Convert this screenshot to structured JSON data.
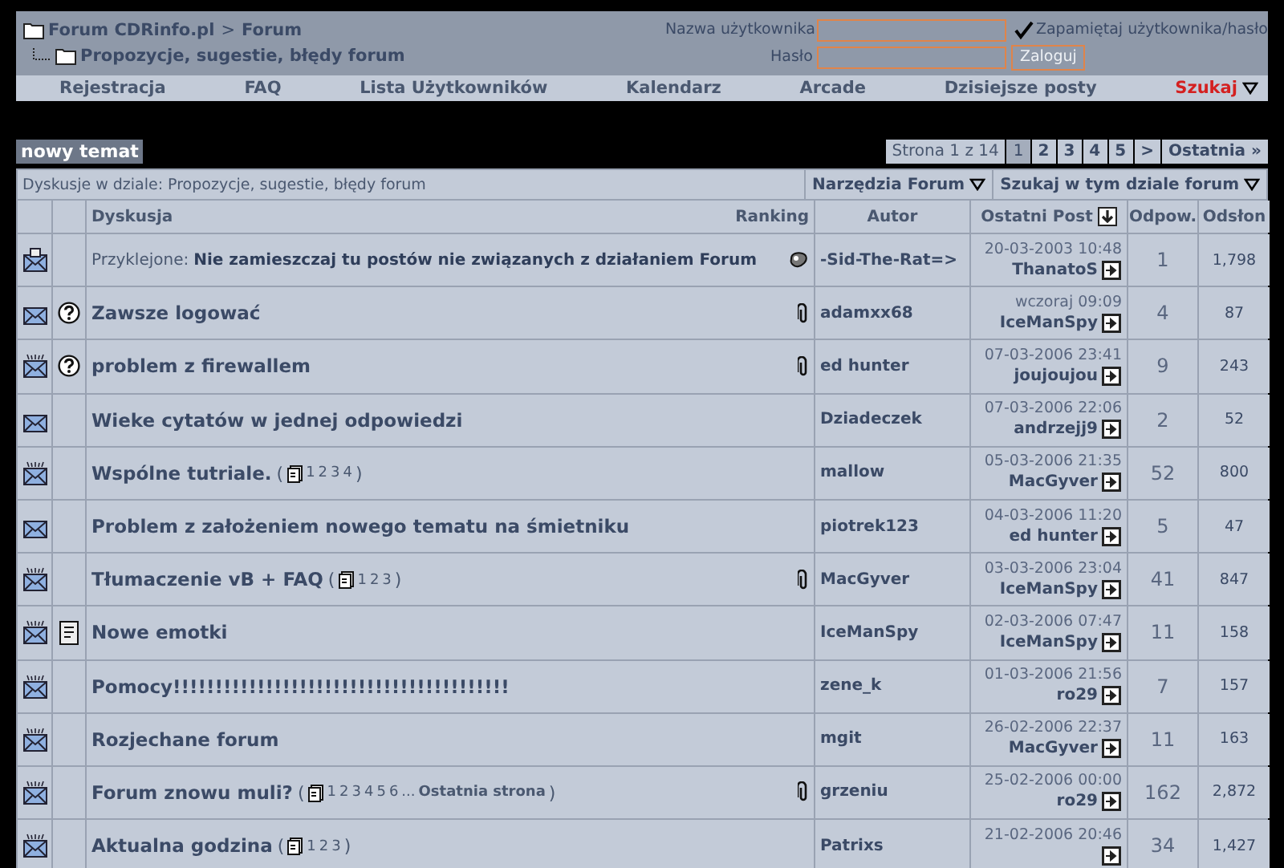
{
  "breadcrumb": {
    "root": "Forum CDRinfo.pl",
    "separator": ">",
    "parent": "Forum",
    "current": "Propozycje, sugestie, błędy forum"
  },
  "login": {
    "username_label": "Nazwa użytkownika",
    "password_label": "Hasło",
    "remember": {
      "label": "Zapamiętaj użytkownika/hasło",
      "checked": true
    },
    "button": "Zaloguj"
  },
  "nav": [
    {
      "label": "Rejestracja",
      "highlighted": false,
      "dropdown": false
    },
    {
      "label": "FAQ",
      "highlighted": false,
      "dropdown": false
    },
    {
      "label": "Lista Użytkowników",
      "highlighted": false,
      "dropdown": false
    },
    {
      "label": "Kalendarz",
      "highlighted": false,
      "dropdown": false
    },
    {
      "label": "Arcade",
      "highlighted": false,
      "dropdown": false
    },
    {
      "label": "Dzisiejsze posty",
      "highlighted": false,
      "dropdown": false
    },
    {
      "label": "Szukaj",
      "highlighted": true,
      "dropdown": true
    }
  ],
  "new_topic_button": "nowy temat",
  "pagination": {
    "summary": "Strona 1 z 14",
    "pages": [
      {
        "label": "1",
        "selected": true
      },
      {
        "label": "2",
        "selected": false
      },
      {
        "label": "3",
        "selected": false
      },
      {
        "label": "4",
        "selected": false
      },
      {
        "label": "5",
        "selected": false
      }
    ],
    "next": ">",
    "last": "Ostatnia »"
  },
  "forum_bar": {
    "title": "Dyskusje w dziale: Propozycje, sugestie, błędy forum",
    "menus": [
      "Narzędzia Forum",
      "Szukaj w tym dziale forum"
    ]
  },
  "table": {
    "columns": {
      "topic": "Dyskusja",
      "rating": "Ranking",
      "author": "Autor",
      "last_post": "Ostatni Post",
      "replies": "Odpow.",
      "views": "Odsłon"
    },
    "rows": [
      {
        "kind": "sticky",
        "prefix": "Przyklejone:",
        "title": "Nie zamieszczaj tu postów nie związanych z działaniem Forum",
        "attachment": false,
        "rated": true,
        "author": "-Sid-The-Rat=>",
        "date": "20-03-2003 10:48",
        "last_poster": "ThanatoS",
        "replies": "1",
        "views": "1,798"
      },
      {
        "kind": "old",
        "post_icon": {
          "kind": "question"
        },
        "title": "Zawsze logować",
        "attachment": true,
        "author": "adamxx68",
        "date": "wczoraj 09:09",
        "last_poster": "IceManSpy",
        "replies": "4",
        "views": "87"
      },
      {
        "kind": "new",
        "post_icon": {
          "kind": "question"
        },
        "title": "problem z firewallem",
        "attachment": true,
        "author": "ed hunter",
        "date": "07-03-2006 23:41",
        "last_poster": "joujoujou",
        "replies": "9",
        "views": "243"
      },
      {
        "kind": "old",
        "title": "Wieke cytatów w jednej odpowiedzi",
        "attachment": false,
        "author": "Dziadeczek",
        "date": "07-03-2006 22:06",
        "last_poster": "andrzejj9",
        "replies": "2",
        "views": "52"
      },
      {
        "kind": "new",
        "title": "Wspólne tutriale.",
        "pages": {
          "open": "(",
          "links": [
            "1",
            "2",
            "3",
            "4"
          ],
          "close": ")"
        },
        "attachment": false,
        "author": "mallow",
        "date": "05-03-2006 21:35",
        "last_poster": "MacGyver",
        "replies": "52",
        "views": "800"
      },
      {
        "kind": "old",
        "title": "Problem z założeniem nowego tematu na śmietniku",
        "attachment": false,
        "author": "piotrek123",
        "date": "04-03-2006 11:20",
        "last_poster": "ed hunter",
        "replies": "5",
        "views": "47"
      },
      {
        "kind": "new",
        "title": "Tłumaczenie vB + FAQ",
        "pages": {
          "open": "(",
          "links": [
            "1",
            "2",
            "3"
          ],
          "close": ")"
        },
        "attachment": true,
        "author": "MacGyver",
        "date": "03-03-2006 23:04",
        "last_poster": "IceManSpy",
        "replies": "41",
        "views": "847"
      },
      {
        "kind": "new",
        "post_icon": {
          "kind": "note"
        },
        "title": "Nowe emotki",
        "attachment": false,
        "author": "IceManSpy",
        "date": "02-03-2006 07:47",
        "last_poster": "IceManSpy",
        "replies": "11",
        "views": "158"
      },
      {
        "kind": "new",
        "title": "Pomocy!!!!!!!!!!!!!!!!!!!!!!!!!!!!!!!!!!!!!!!!",
        "attachment": false,
        "author": "zene_k",
        "date": "01-03-2006 21:56",
        "last_poster": "ro29",
        "replies": "7",
        "views": "157"
      },
      {
        "kind": "new",
        "title": "Rozjechane forum",
        "attachment": false,
        "author": "mgit",
        "date": "26-02-2006 22:37",
        "last_poster": "MacGyver",
        "replies": "11",
        "views": "163"
      },
      {
        "kind": "new",
        "title": "Forum znowu muli?",
        "pages": {
          "open": "(",
          "links": [
            "1",
            "2",
            "3",
            "4",
            "5",
            "6"
          ],
          "more": "...",
          "last": "Ostatnia strona",
          "close": ")"
        },
        "attachment": true,
        "author": "grzeniu",
        "date": "25-02-2006 00:00",
        "last_poster": "ro29",
        "replies": "162",
        "views": "2,872"
      },
      {
        "kind": "new",
        "title": "Aktualna godzina",
        "pages": {
          "open": "(",
          "links": [
            "1",
            "2",
            "3"
          ],
          "close": ")"
        },
        "attachment": false,
        "author": "Patrixs",
        "date": "21-02-2006 20:46",
        "replies": "34",
        "views": "1,427"
      }
    ]
  }
}
